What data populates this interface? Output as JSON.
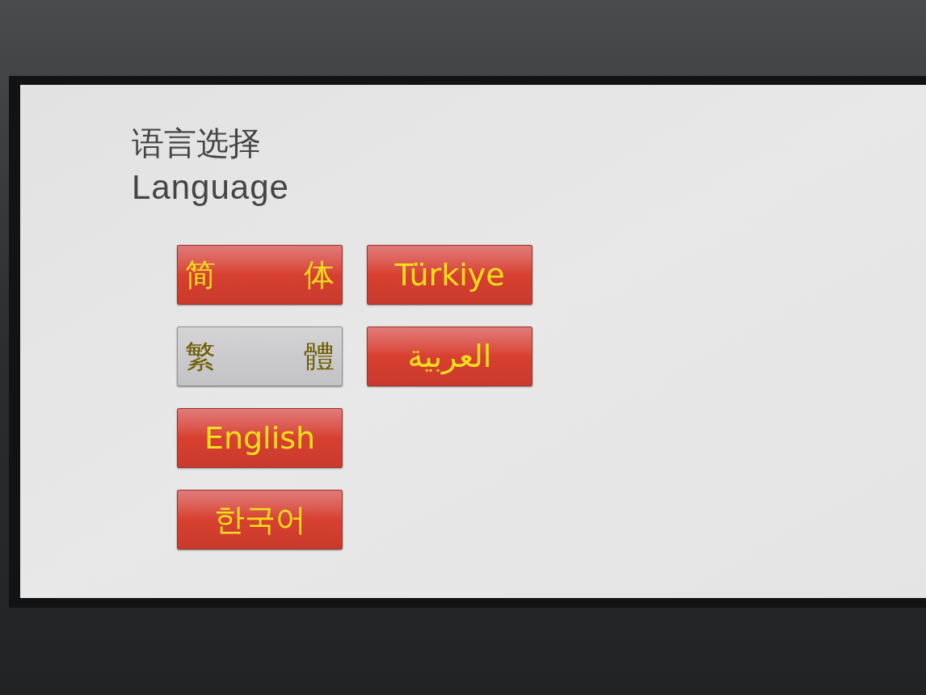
{
  "title": "语言选择",
  "subtitle": "Language",
  "languages": [
    {
      "label": "简 体",
      "selected": false
    },
    {
      "label": "繁 體",
      "selected": true
    },
    {
      "label": "English",
      "selected": false
    },
    {
      "label": "한국어",
      "selected": false
    },
    {
      "label": "Türkiye",
      "selected": false
    },
    {
      "label": "العربية",
      "selected": false
    }
  ]
}
